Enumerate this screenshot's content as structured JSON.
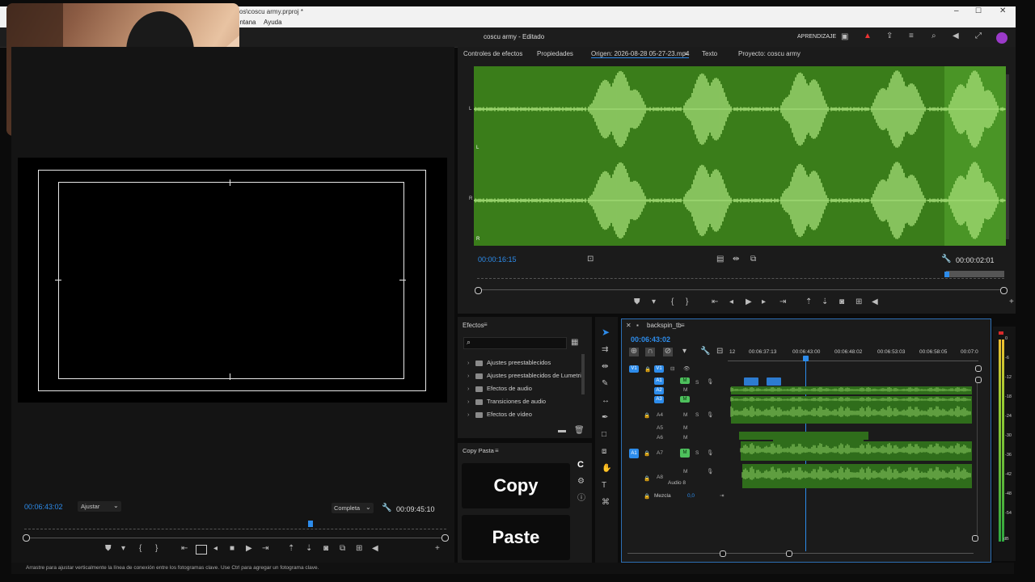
{
  "window": {
    "title": "vos\\coscu army.prproj *",
    "menu": [
      "entana",
      "Ayuda"
    ],
    "project_label": "coscu army - Editado",
    "learn_label": "APRENDIZAJE"
  },
  "source_panel": {
    "tabs": [
      "Controles de efectos",
      "Propiedades",
      "Origen: 2026-08-28 05-27-23.mp4",
      "Texto",
      "Proyecto: coscu army"
    ],
    "channel_labels": [
      "L",
      "L",
      "R",
      "R"
    ],
    "timecode_in": "00:00:16:15",
    "timecode_dur": "00:00:02:01"
  },
  "program_monitor": {
    "timecode": "00:06:43:02",
    "fit": "Ajustar",
    "resolution": "Completa",
    "duration": "00:09:45:10"
  },
  "effects_panel": {
    "title": "Efectos",
    "search_placeholder": "",
    "items": [
      "Ajustes preestablecidos",
      "Ajustes preestablecidos de Lumetri",
      "Efectos de audio",
      "Transiciones de audio",
      "Efectos de vídeo"
    ]
  },
  "copy_paste": {
    "title": "Copy Pasta",
    "copy": "Copy",
    "paste": "Paste",
    "c_label": "C"
  },
  "timeline": {
    "sequence": "backspin_tb",
    "timecode": "00:06:43:02",
    "ruler": [
      "12",
      "00:06:37:13",
      "00:06:43:00",
      "00:06:48:02",
      "00:06:53:03",
      "00:06:58:05",
      "00:07:0"
    ],
    "video_track": "V1",
    "audio_tracks": [
      "A1",
      "A2",
      "A3",
      "A4",
      "A5",
      "A6",
      "A7",
      "A8"
    ],
    "audio8_name": "Audio 8",
    "mix_label": "Mezcla",
    "mix_value": "0,0",
    "meter_labels": [
      "0",
      "-6",
      "-12",
      "-18",
      "-24",
      "-30",
      "-36",
      "-42",
      "-48",
      "-54",
      "dB"
    ]
  },
  "status_bar": {
    "text": "Arrastre para ajustar verticalmente la línea de conexión entre los fotogramas clave. Use Ctrl para agregar un fotograma clave."
  },
  "colors": {
    "accent": "#2d8ceb",
    "waveform_bg": "#3a7d1a",
    "waveform": "#a8e07a",
    "track_green": "#4dc05c"
  }
}
